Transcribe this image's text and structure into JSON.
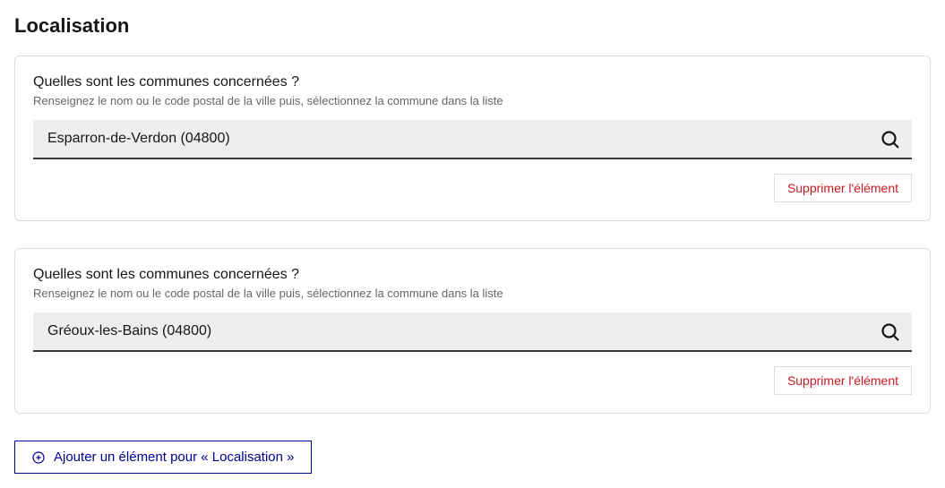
{
  "section": {
    "title": "Localisation"
  },
  "items": [
    {
      "label": "Quelles sont les communes concernées ?",
      "help": "Renseignez le nom ou le code postal de la ville puis, sélectionnez la commune dans la liste",
      "value": "Esparron-de-Verdon (04800)",
      "delete_label": "Supprimer l'élément"
    },
    {
      "label": "Quelles sont les communes concernées ?",
      "help": "Renseignez le nom ou le code postal de la ville puis, sélectionnez la commune dans la liste",
      "value": "Gréoux-les-Bains (04800)",
      "delete_label": "Supprimer l'élément"
    }
  ],
  "add_button": {
    "label": "Ajouter un élément pour « Localisation »"
  }
}
